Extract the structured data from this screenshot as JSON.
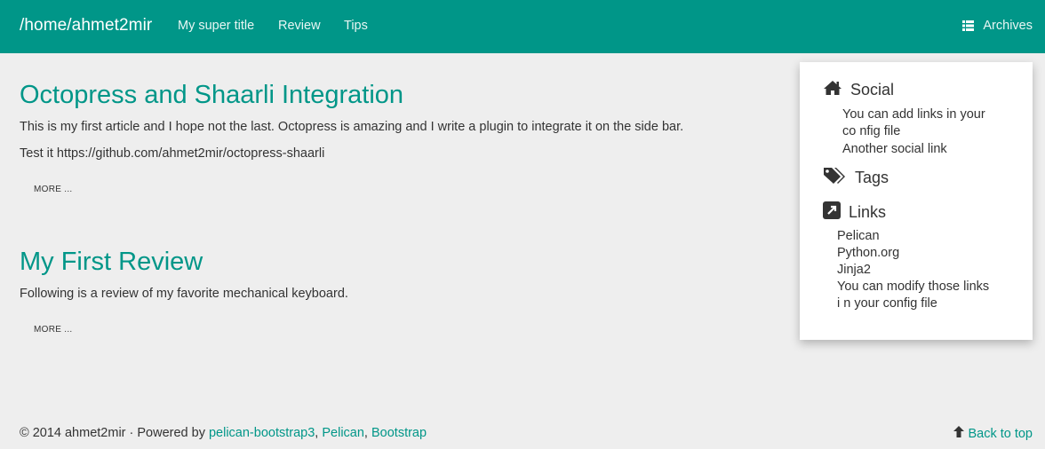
{
  "colors": {
    "accent": "#009688",
    "background": "#eeeeee",
    "text": "#333333"
  },
  "navbar": {
    "brand": "/home/ahmet2mir",
    "links": [
      "My super title",
      "Review",
      "Tips"
    ],
    "archives_label": "Archives",
    "archives_icon": "list-icon"
  },
  "articles": [
    {
      "title": "Octopress and Shaarli Integration",
      "paragraphs": [
        "This is my first article and I hope not the last. Octopress is amazing and I write a plugin to integrate it on the side bar.",
        "Test it https://github.com/ahmet2mir/octopress-shaarli"
      ],
      "more_label": "MORE ..."
    },
    {
      "title": "My First Review",
      "paragraphs": [
        "Following is a review of my favorite mechanical keyboard."
      ],
      "more_label": "MORE ..."
    }
  ],
  "sidebar": {
    "social": {
      "title": "Social",
      "icon": "home-icon",
      "items": [
        "You can add links in your co nfig file",
        "Another social link"
      ]
    },
    "tags": {
      "title": "Tags",
      "icon": "tags-icon"
    },
    "links": {
      "title": "Links",
      "icon": "external-link-icon",
      "items": [
        "Pelican",
        "Python.org",
        "Jinja2",
        "You can modify those links i n your config file"
      ]
    }
  },
  "footer": {
    "copyright": "© 2014 ahmet2mir · Powered by ",
    "links": [
      "pelican-bootstrap3",
      "Pelican",
      "Bootstrap"
    ],
    "separator": ", ",
    "back_to_top": "Back to top",
    "back_to_top_icon": "arrow-up-icon"
  }
}
